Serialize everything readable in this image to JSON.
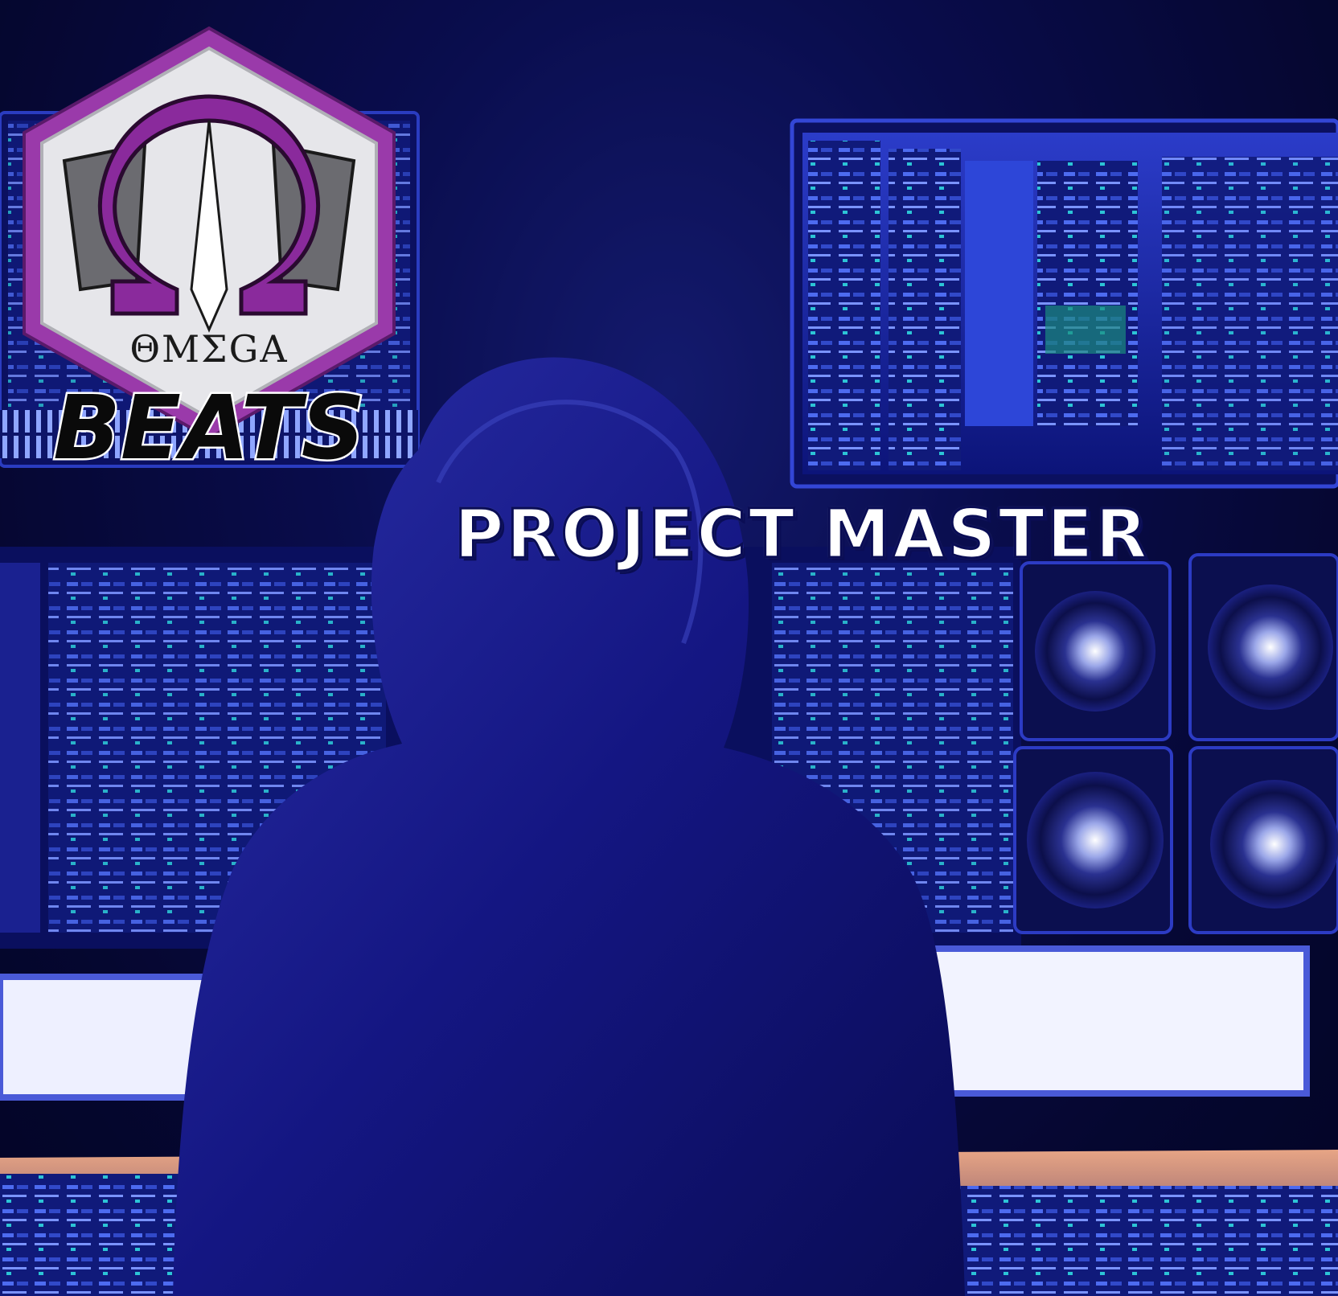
{
  "logo": {
    "brand": "ΘMΣGA",
    "sub": "BEATS",
    "colors": {
      "purple": "#8a2a9c",
      "silver": "#d9d9dc",
      "dark": "#0a0a0a"
    }
  },
  "title": {
    "text": "PROJECT MASTER"
  },
  "scene": {
    "subject": "hooded-producer",
    "colors": {
      "hoodie": "#13157a",
      "monitor": "#2a3fd0",
      "glow": "#6f8bff",
      "desk": "#d99a7a"
    }
  }
}
